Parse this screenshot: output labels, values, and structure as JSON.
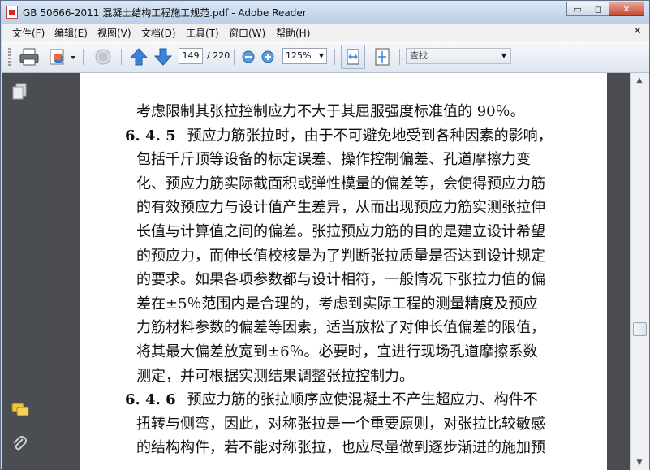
{
  "window": {
    "title": "GB 50666-2011 混凝土结构工程施工规范.pdf - Adobe Reader",
    "minimize": "▭",
    "maximize": "◻",
    "close": "✕"
  },
  "menubar": {
    "items": [
      "文件(F)",
      "编辑(E)",
      "视图(V)",
      "文档(D)",
      "工具(T)",
      "窗口(W)",
      "帮助(H)"
    ],
    "close_doc": "✕"
  },
  "toolbar": {
    "page_current": "149",
    "page_total": "/ 220",
    "zoom": "125%",
    "find_placeholder": "查找",
    "icons": [
      "print-icon",
      "share-email-icon",
      "hand-tool-icon",
      "previous-page-icon",
      "next-page-icon",
      "zoom-out-icon",
      "zoom-in-icon",
      "fit-width-icon",
      "fit-page-icon"
    ]
  },
  "navpane": {
    "icons": [
      "pages-panel-icon",
      "comments-icon",
      "attachments-icon"
    ]
  },
  "document": {
    "lines": [
      {
        "num": "",
        "text": "考虑限制其张拉控制应力不大于其屈服强度标准值的 90％。"
      },
      {
        "num": "6. 4. 5",
        "text": "预应力筋张拉时，由于不可避免地受到各种因素的影响，"
      },
      {
        "num": "",
        "text": "包括千斤顶等设备的标定误差、操作控制偏差、孔道摩擦力变"
      },
      {
        "num": "",
        "text": "化、预应力筋实际截面积或弹性模量的偏差等，会使得预应力筋"
      },
      {
        "num": "",
        "text": "的有效预应力与设计值产生差异，从而出现预应力筋实测张拉伸"
      },
      {
        "num": "",
        "text": "长值与计算值之间的偏差。张拉预应力筋的目的是建立设计希望"
      },
      {
        "num": "",
        "text": "的预应力，而伸长值校核是为了判断张拉质量是否达到设计规定"
      },
      {
        "num": "",
        "text": "的要求。如果各项参数都与设计相符，一般情况下张拉力值的偏"
      },
      {
        "num": "",
        "text": "差在±5％范围内是合理的，考虑到实际工程的测量精度及预应"
      },
      {
        "num": "",
        "text": "力筋材料参数的偏差等因素，适当放松了对伸长值偏差的限值，"
      },
      {
        "num": "",
        "text": "将其最大偏差放宽到±6％。必要时，宜进行现场孔道摩擦系数"
      },
      {
        "num": "",
        "text": "测定，并可根据实测结果调整张拉控制力。"
      },
      {
        "num": "6. 4. 6",
        "text": "预应力筋的张拉顺序应使混凝土不产生超应力、构件不"
      },
      {
        "num": "",
        "text": "扭转与侧弯，因此，对称张拉是一个重要原则，对张拉比较敏感"
      },
      {
        "num": "",
        "text": "的结构构件，若不能对称张拉，也应尽量做到逐步渐进的施加预"
      }
    ]
  },
  "scrollbar": {
    "up": "▲",
    "down": "▼"
  }
}
